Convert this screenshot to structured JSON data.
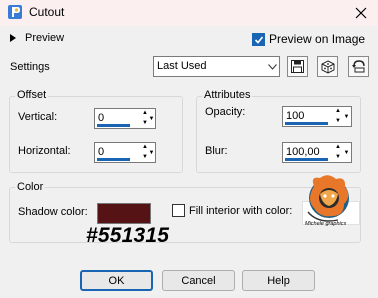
{
  "window": {
    "title": "Cutout"
  },
  "preview": {
    "label": "Preview",
    "preview_on_image_label": "Preview on Image",
    "preview_on_image_checked": true
  },
  "settings": {
    "label": "Settings",
    "selected": "Last Used"
  },
  "offset": {
    "title": "Offset",
    "vertical_label": "Vertical:",
    "vertical_value": "0",
    "horizontal_label": "Horizontal:",
    "horizontal_value": "0"
  },
  "attributes": {
    "title": "Attributes",
    "opacity_label": "Opacity:",
    "opacity_value": "100",
    "blur_label": "Blur:",
    "blur_value": "100,00"
  },
  "color": {
    "title": "Color",
    "shadow_color_label": "Shadow color:",
    "shadow_color_hex": "#551315",
    "shadow_color_annotation": "#551315",
    "fill_interior_label": "Fill interior with color:",
    "fill_interior_checked": false,
    "watermark_text": "Michele graphics"
  },
  "buttons": {
    "ok": "OK",
    "cancel": "Cancel",
    "help": "Help"
  },
  "colors": {
    "accent": "#1a64b4",
    "titlebar": "#fbeff0",
    "background": "#f0f0f0"
  }
}
